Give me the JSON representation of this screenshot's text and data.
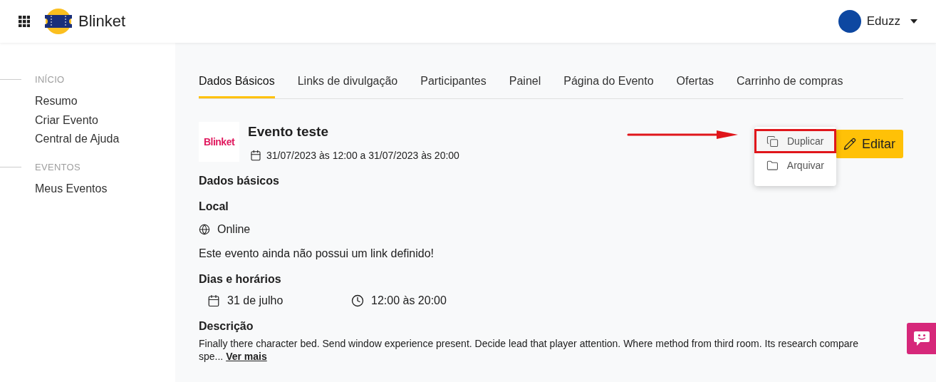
{
  "header": {
    "brand": "Blinket",
    "user": {
      "name": "Eduzz"
    }
  },
  "sidebar": {
    "sections": [
      {
        "title": "INÍCIO",
        "items": [
          {
            "label": "Resumo"
          },
          {
            "label": "Criar Evento"
          },
          {
            "label": "Central de Ajuda"
          }
        ]
      },
      {
        "title": "EVENTOS",
        "items": [
          {
            "label": "Meus Eventos"
          }
        ]
      }
    ]
  },
  "tabs": [
    {
      "label": "Dados Básicos",
      "selected": true
    },
    {
      "label": "Links de divulgação",
      "selected": false
    },
    {
      "label": "Participantes",
      "selected": false
    },
    {
      "label": "Painel",
      "selected": false
    },
    {
      "label": "Página do Evento",
      "selected": false
    },
    {
      "label": "Ofertas",
      "selected": false
    },
    {
      "label": "Carrinho de compras",
      "selected": false
    }
  ],
  "event": {
    "logo_text": "Blinket",
    "title": "Evento teste",
    "date_range": "31/07/2023 às 12:00 a 31/07/2023 às 20:00"
  },
  "menu": {
    "items": [
      {
        "kind": "duplicate",
        "label": "Duplicar",
        "selected": true
      },
      {
        "kind": "archive",
        "label": "Arquivar",
        "selected": false
      }
    ]
  },
  "edit_button": "Editar",
  "details": {
    "section_title": "Dados básicos",
    "local_title": "Local",
    "location": "Online",
    "link_note": "Este evento ainda não possui um link definido!",
    "schedule_title": "Dias e horários",
    "day": "31 de julho",
    "hours": "12:00 às 20:00",
    "description_title": "Descrição",
    "description": "Finally there character bed. Send window experience present. Decide lead that player attention. Where method from third room. Its research compare spe...",
    "more_link": "Ver mais"
  }
}
